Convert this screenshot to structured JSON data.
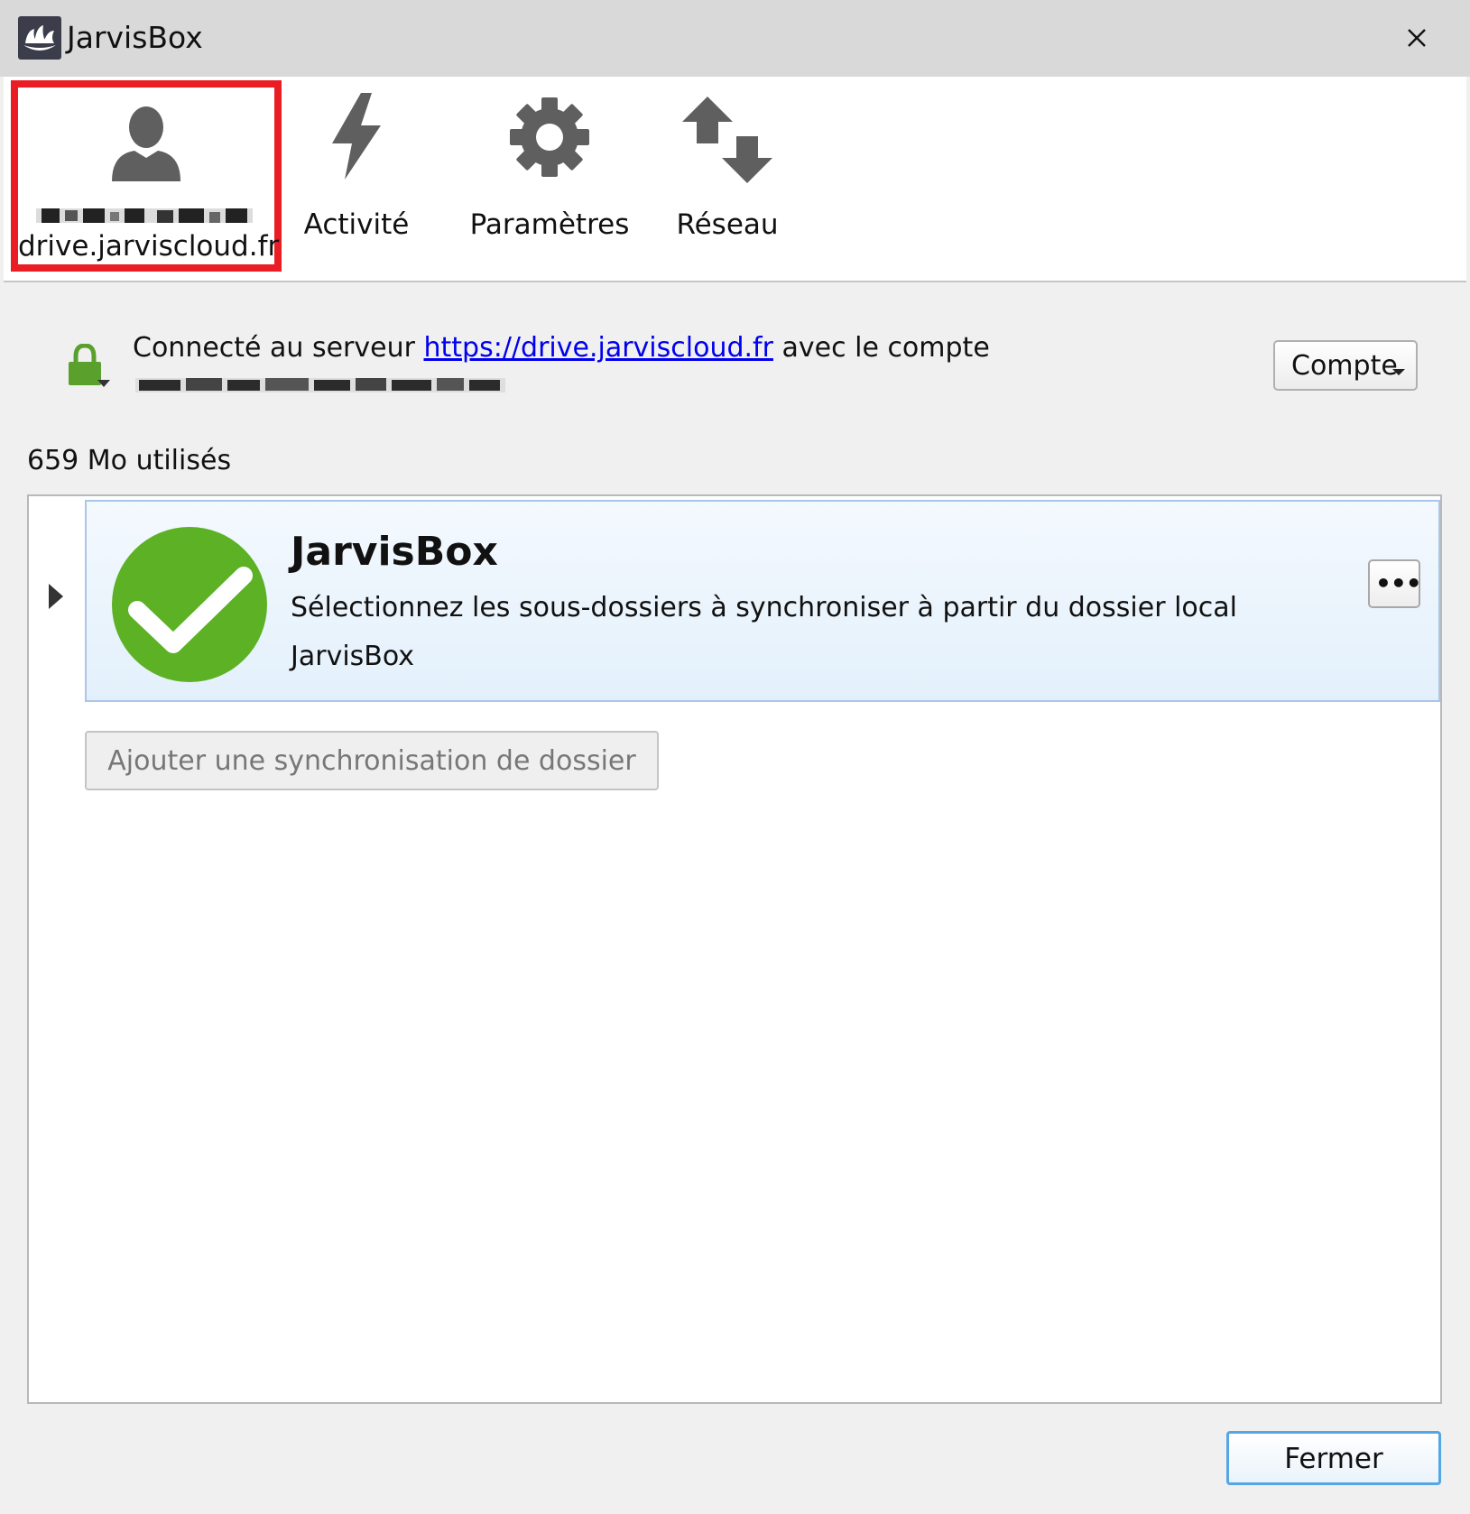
{
  "window": {
    "title": "JarvisBox",
    "close_icon": "×"
  },
  "toolbar": {
    "account": {
      "name_redacted": true,
      "host": "drive.jarviscloud.fr"
    },
    "activity_label": "Activité",
    "settings_label": "Paramètres",
    "network_label": "Réseau"
  },
  "status": {
    "prefix": "Connecté au serveur",
    "link": "https://drive.jarviscloud.fr",
    "suffix": "avec le compte",
    "email_redacted": true
  },
  "account_menu": {
    "label": "Compte"
  },
  "usage": {
    "text": "659 Mo utilisés"
  },
  "folders": [
    {
      "name": "JarvisBox",
      "description": "Sélectionnez les sous-dossiers à synchroniser à partir du dossier local",
      "local_folder": "JarvisBox",
      "more_label": "•••"
    }
  ],
  "actions": {
    "add_sync_label": "Ajouter une synchronisation de dossier",
    "close_label": "Fermer"
  },
  "colors": {
    "highlight_border": "#ea1d25",
    "sync_ok": "#5cb124",
    "lock": "#5aa02c",
    "link": "#0000ee",
    "row_border": "#a9c7e8",
    "default_button_border": "#55a6e4"
  }
}
